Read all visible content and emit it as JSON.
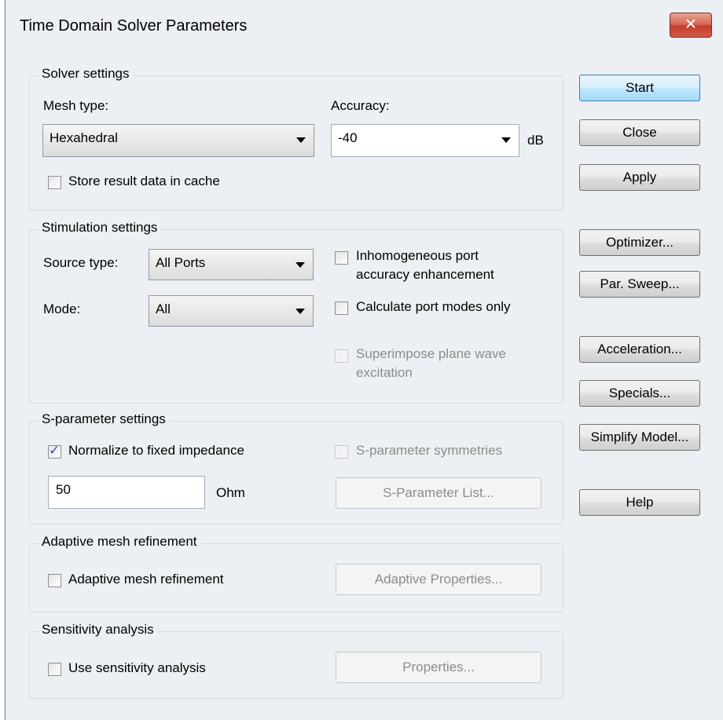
{
  "window": {
    "title": "Time Domain Solver Parameters",
    "close_label": "✕"
  },
  "solver_settings": {
    "group_label": "Solver settings",
    "mesh_type_label": "Mesh type:",
    "mesh_type_value": "Hexahedral",
    "accuracy_label": "Accuracy:",
    "accuracy_value": "-40",
    "accuracy_unit": "dB",
    "store_cache_label": "Store result data in cache",
    "store_cache_checked": false
  },
  "stimulation_settings": {
    "group_label": "Stimulation settings",
    "source_type_label": "Source type:",
    "source_type_value": "All Ports",
    "mode_label": "Mode:",
    "mode_value": "All",
    "inhomogeneous_line1": "Inhomogeneous port",
    "inhomogeneous_line2": "accuracy enhancement",
    "calc_port_modes_label": "Calculate port modes only",
    "superimpose_line1": "Superimpose plane wave",
    "superimpose_line2": "excitation"
  },
  "sparam_settings": {
    "group_label": "S-parameter settings",
    "normalize_label": "Normalize to fixed impedance",
    "normalize_checked": true,
    "symmetries_label": "S-parameter symmetries",
    "impedance_value": "50",
    "impedance_unit": "Ohm",
    "list_button": "S-Parameter List..."
  },
  "adaptive": {
    "group_label": "Adaptive mesh refinement",
    "checkbox_label": "Adaptive mesh refinement",
    "properties_button": "Adaptive Properties..."
  },
  "sensitivity": {
    "group_label": "Sensitivity analysis",
    "checkbox_label": "Use sensitivity analysis",
    "properties_button": "Properties..."
  },
  "buttons": {
    "start": "Start",
    "close": "Close",
    "apply": "Apply",
    "optimizer": "Optimizer...",
    "par_sweep": "Par. Sweep...",
    "acceleration": "Acceleration...",
    "specials": "Specials...",
    "simplify_model": "Simplify Model...",
    "help": "Help"
  },
  "colors": {
    "close_button": "#c43d2b",
    "default_button": "#a7d9f5",
    "check_tick": "#2a54a8"
  }
}
